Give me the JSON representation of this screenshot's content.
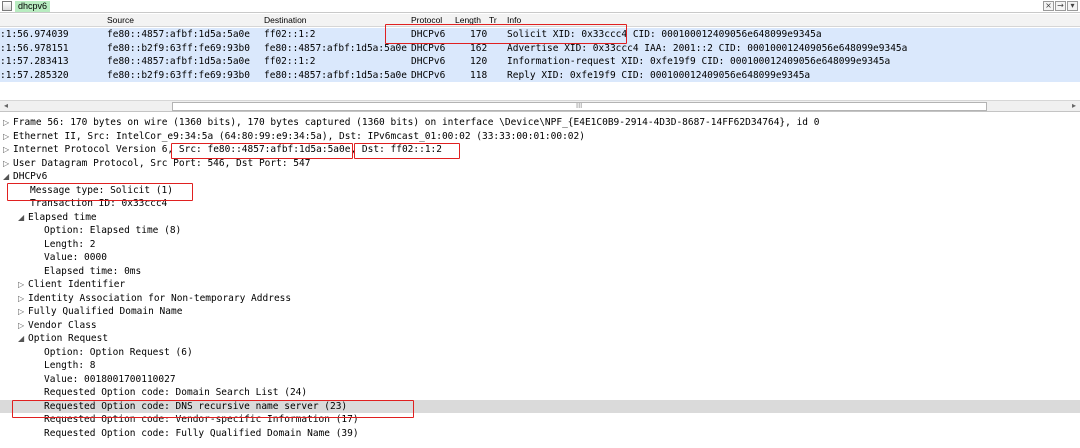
{
  "filter": {
    "value": "dhcpv6",
    "icon": "filter-bookmark-icon"
  },
  "window_controls": [
    "x-icon",
    "arrow-icon",
    "dropdown-icon"
  ],
  "columns": {
    "source": "Source",
    "destination": "Destination",
    "protocol": "Protocol",
    "length": "Length",
    "tr": "Tr",
    "info": "Info"
  },
  "packets": [
    {
      "time": ":1:56.974039",
      "src": "fe80::4857:afbf:1d5a:5a0e",
      "dst": "ff02::1:2",
      "proto": "DHCPv6",
      "len": "170",
      "info": "Solicit XID: 0x33ccc4 CID: 000100012409056e648099e9345a"
    },
    {
      "time": ":1:56.978151",
      "src": "fe80::b2f9:63ff:fe69:93b0",
      "dst": "fe80::4857:afbf:1d5a:5a0e",
      "proto": "DHCPv6",
      "len": "162",
      "info": "Advertise XID: 0x33ccc4 IAA: 2001::2 CID: 000100012409056e648099e9345a"
    },
    {
      "time": ":1:57.283413",
      "src": "fe80::4857:afbf:1d5a:5a0e",
      "dst": "ff02::1:2",
      "proto": "DHCPv6",
      "len": "120",
      "info": "Information-request XID: 0xfe19f9 CID: 000100012409056e648099e9345a"
    },
    {
      "time": ":1:57.285320",
      "src": "fe80::b2f9:63ff:fe69:93b0",
      "dst": "fe80::4857:afbf:1d5a:5a0e",
      "proto": "DHCPv6",
      "len": "118",
      "info": "Reply XID: 0xfe19f9 CID: 000100012409056e648099e9345a"
    }
  ],
  "scrollbar": {
    "grip": "III",
    "left": "◂",
    "right": "▸"
  },
  "detail": {
    "frame": "Frame 56: 170 bytes on wire (1360 bits), 170 bytes captured (1360 bits) on interface \\Device\\NPF_{E4E1C0B9-2914-4D3D-8687-14FF62D34764}, id 0",
    "ethernet": "Ethernet II, Src: IntelCor_e9:34:5a (64:80:99:e9:34:5a), Dst: IPv6mcast_01:00:02 (33:33:00:01:00:02)",
    "ip_prefix": "Internet Protocol Version 6, ",
    "ip_src": "Src: fe80::4857:afbf:1d5a:5a0e",
    "ip_sep": ", ",
    "ip_dst": "Dst: ff02::1:2",
    "udp": "User Datagram Protocol, Src Port: 546, Dst Port: 547",
    "dhcpv6": "DHCPv6",
    "message_type": "Message type: Solicit (1)",
    "transaction_id": "Transaction ID: 0x33ccc4",
    "elapsed_time": "Elapsed time",
    "elapsed_option": "Option: Elapsed time (8)",
    "elapsed_length": "Length: 2",
    "elapsed_value": "Value: 0000",
    "elapsed_ms": "Elapsed time: 0ms",
    "client_identifier": "Client Identifier",
    "identity_association": "Identity Association for Non-temporary Address",
    "fqdn": "Fully Qualified Domain Name",
    "vendor_class": "Vendor Class",
    "option_request": "Option Request",
    "or_option": "Option: Option Request (6)",
    "or_length": "Length: 8",
    "or_value": "Value: 0018001700110027",
    "req1": "Requested Option code: Domain Search List (24)",
    "req2": "Requested Option code: DNS recursive name server (23)",
    "req3": "Requested Option code: Vendor-specific Information (17)",
    "req4": "Requested Option code: Fully Qualified Domain Name (39)"
  },
  "toggles": {
    "collapsed": "▷",
    "expanded": "◢"
  },
  "colors": {
    "row_bg": "#dae8fc",
    "highlight": "#e02020",
    "filter_bg": "#b8ecc0"
  }
}
